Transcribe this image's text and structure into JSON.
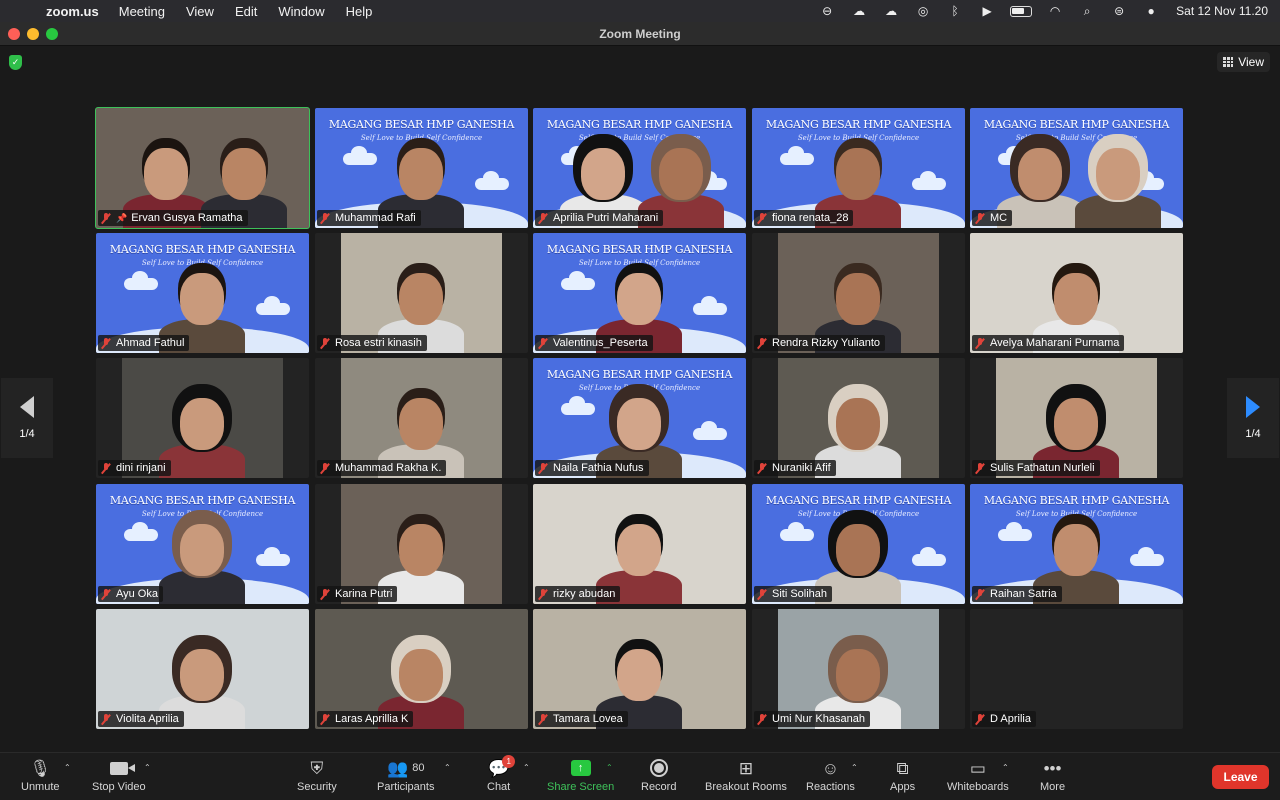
{
  "menubar": {
    "app_name": "zoom.us",
    "menus": [
      "Meeting",
      "View",
      "Edit",
      "Window",
      "Help"
    ],
    "clock": "Sat 12 Nov  11.20"
  },
  "window": {
    "title": "Zoom Meeting"
  },
  "stage": {
    "view_label": "View",
    "page_indicator_left": "1/4",
    "page_indicator_right": "1/4"
  },
  "banner": {
    "title": "MAGANG BESAR HMP GANESHA",
    "subtitle": "Self Love to Build Self Confidence"
  },
  "participants": [
    {
      "name": "Ervan Gusya Ramatha",
      "bg": "room",
      "active": true,
      "pinned": true
    },
    {
      "name": "Muhammad Rafi",
      "bg": "banner"
    },
    {
      "name": "Aprilia Putri Maharani",
      "bg": "banner"
    },
    {
      "name": "fiona renata_28",
      "bg": "banner"
    },
    {
      "name": "MC",
      "bg": "banner"
    },
    {
      "name": "Ahmad Fathul",
      "bg": "banner"
    },
    {
      "name": "Rosa estri kinasih",
      "bg": "room"
    },
    {
      "name": "Valentinus_Peserta",
      "bg": "banner"
    },
    {
      "name": "Rendra Rizky Yulianto",
      "bg": "room"
    },
    {
      "name": "Avelya Maharani Purnama",
      "bg": "room"
    },
    {
      "name": "dini rinjani",
      "bg": "room"
    },
    {
      "name": "Muhammad Rakha K.",
      "bg": "room"
    },
    {
      "name": "Naila Fathia Nufus",
      "bg": "banner"
    },
    {
      "name": "Nuraniki Afif",
      "bg": "room"
    },
    {
      "name": "Sulis Fathatun Nurleli",
      "bg": "room"
    },
    {
      "name": "Ayu Oka",
      "bg": "banner"
    },
    {
      "name": "Karina Putri",
      "bg": "room"
    },
    {
      "name": "rizky abudan",
      "bg": "room"
    },
    {
      "name": "Siti Solihah",
      "bg": "banner"
    },
    {
      "name": "Raihan Satria",
      "bg": "banner"
    },
    {
      "name": "Violita Aprilia",
      "bg": "room"
    },
    {
      "name": "Laras Aprillia K",
      "bg": "room"
    },
    {
      "name": "Tamara Lovea",
      "bg": "room"
    },
    {
      "name": "Umi Nur Khasanah",
      "bg": "room"
    },
    {
      "name": "D Aprilia",
      "bg": "none"
    }
  ],
  "toolbar": {
    "unmute": "Unmute",
    "stop_video": "Stop Video",
    "security": "Security",
    "participants": "Participants",
    "participants_count": "80",
    "chat": "Chat",
    "chat_badge": "1",
    "share_screen": "Share Screen",
    "record": "Record",
    "breakout_rooms": "Breakout Rooms",
    "reactions": "Reactions",
    "apps": "Apps",
    "whiteboards": "Whiteboards",
    "more": "More",
    "leave": "Leave"
  },
  "colors": {
    "accent_green": "#3ec15a",
    "leave_red": "#e0352b",
    "nav_blue": "#2d8cff",
    "banner_blue": "#4a6ee0"
  }
}
